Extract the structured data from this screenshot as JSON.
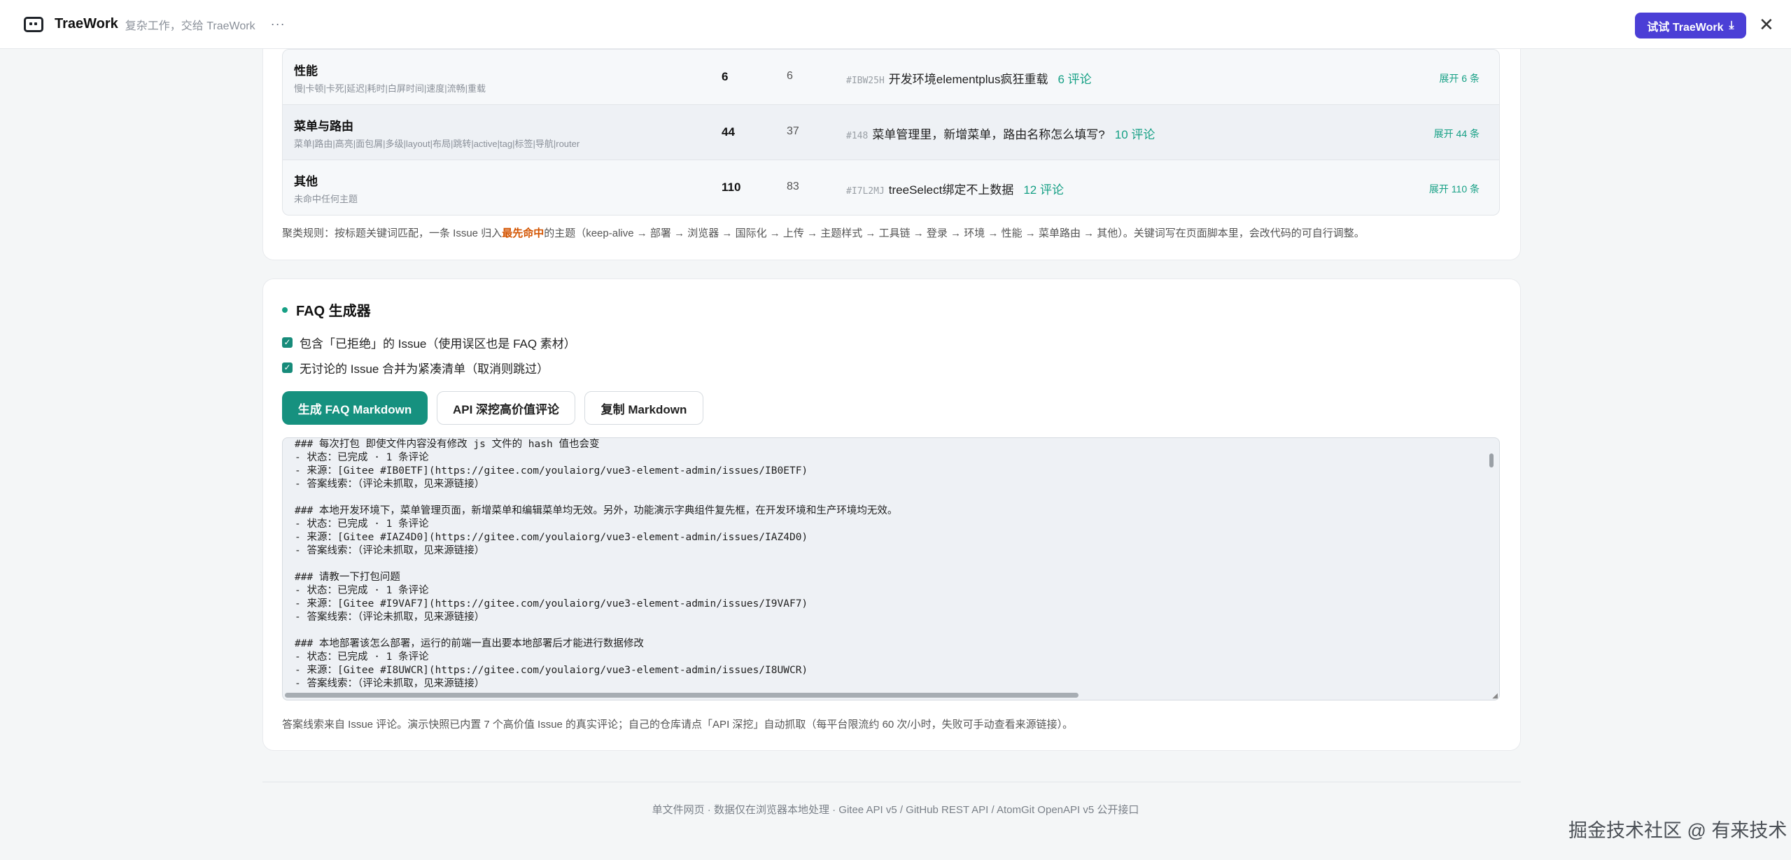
{
  "topbar": {
    "brand": "TraeWork",
    "slogan": "复杂工作，交给 TraeWork",
    "more": "···",
    "try_button": "试试 TraeWork",
    "close": "✕"
  },
  "clusters": {
    "rows": [
      {
        "name": "性能",
        "keywords": "慢|卡顿|卡死|延迟|耗时|白屏时间|速度|流畅|重载",
        "count": "6",
        "count2": "6",
        "issue_id": "#IBW25H",
        "issue_title": "开发环境elementplus疯狂重载",
        "comments": "6 评论",
        "expand": "展开 6 条"
      },
      {
        "name": "菜单与路由",
        "keywords": "菜单|路由|高亮|面包屑|多级|layout|布局|跳转|active|tag|标签|导航|router",
        "count": "44",
        "count2": "37",
        "issue_id": "#148",
        "issue_title": "菜单管理里，新增菜单，路由名称怎么填写?",
        "comments": "10 评论",
        "expand": "展开 44 条"
      },
      {
        "name": "其他",
        "keywords": "未命中任何主题",
        "count": "110",
        "count2": "83",
        "issue_id": "#I7L2MJ",
        "issue_title": "treeSelect绑定不上数据",
        "comments": "12 评论",
        "expand": "展开 110 条"
      }
    ],
    "rule_prefix": "聚类规则：按标题关键词匹配，一条 Issue 归入",
    "rule_highlight": "最先命中",
    "rule_suffix": "的主题（keep-alive → 部署 → 浏览器 → 国际化 → 上传 → 主题样式 → 工具链 → 登录 → 环境 → 性能 → 菜单路由 → 其他）。关键词写在页面脚本里，会改代码的可自行调整。"
  },
  "faq": {
    "title": "FAQ 生成器",
    "option1": "包含「已拒绝」的 Issue（使用误区也是 FAQ 素材）",
    "option2": "无讨论的 Issue 合并为紧凑清单（取消则跳过）",
    "generate_button": "生成 FAQ Markdown",
    "api_button": "API 深挖高价值评论",
    "copy_button": "复制 Markdown",
    "output_lines": [
      "### 每次打包 即使文件内容没有修改 js 文件的 hash 值也会变",
      "- 状态：已完成 · 1 条评论",
      "- 来源：[Gitee #IB0ETF](https://gitee.com/youlaiorg/vue3-element-admin/issues/IB0ETF)",
      "- 答案线索：（评论未抓取，见来源链接）",
      "",
      "### 本地开发环境下，菜单管理页面，新增菜单和编辑菜单均无效。另外，功能演示字典组件复先框，在开发环境和生产环境均无效。",
      "- 状态：已完成 · 1 条评论",
      "- 来源：[Gitee #IAZ4D0](https://gitee.com/youlaiorg/vue3-element-admin/issues/IAZ4D0)",
      "- 答案线索：（评论未抓取，见来源链接）",
      "",
      "### 请教一下打包问题",
      "- 状态：已完成 · 1 条评论",
      "- 来源：[Gitee #I9VAF7](https://gitee.com/youlaiorg/vue3-element-admin/issues/I9VAF7)",
      "- 答案线索：（评论未抓取，见来源链接）",
      "",
      "### 本地部署该怎么部署，运行的前端一直出要本地部署后才能进行数据修改",
      "- 状态：已完成 · 1 条评论",
      "- 来源：[Gitee #I8UWCR](https://gitee.com/youlaiorg/vue3-element-admin/issues/I8UWCR)",
      "- 答案线索：（评论未抓取，见来源链接）"
    ],
    "note": "答案线索来自 Issue 评论。演示快照已内置 7 个高价值 Issue 的真实评论；自己的仓库请点「API 深挖」自动抓取（每平台限流约 60 次/小时，失败可手动查看来源链接）。"
  },
  "footer": {
    "text": "单文件网页 · 数据仅在浏览器本地处理 · Gitee API v5 / GitHub REST API / AtomGit OpenAPI v5 公开接口",
    "watermark": "掘金技术社区 @ 有来技术"
  },
  "colors": {
    "accent": "#16917f",
    "brand_button": "#4b3fd6",
    "highlight": "#d35400"
  }
}
